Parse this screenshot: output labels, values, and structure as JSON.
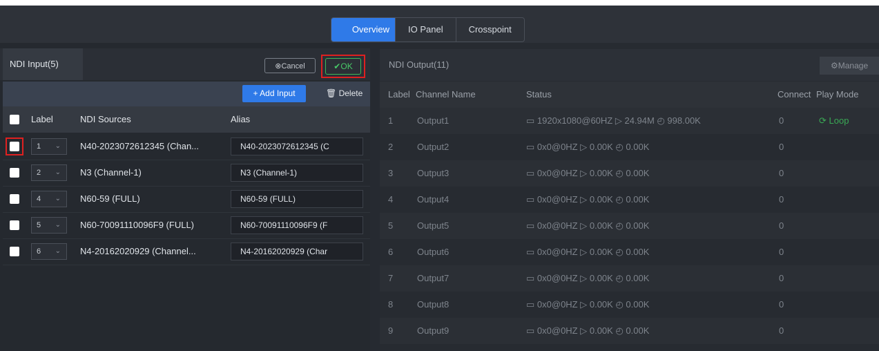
{
  "tabs": [
    "Overview",
    "IO Panel",
    "Crosspoint"
  ],
  "input_panel": {
    "title": "NDI Input(5)",
    "cancel_label": "Cancel",
    "ok_label": "OK",
    "add_label": "+ Add Input",
    "delete_label": "Delete",
    "columns": {
      "label": "Label",
      "sources": "NDI Sources",
      "alias": "Alias"
    },
    "rows": [
      {
        "label": "1",
        "source": "N40-2023072612345 (Chan...",
        "alias": "N40-2023072612345 (C"
      },
      {
        "label": "2",
        "source": "N3 (Channel-1)",
        "alias": "N3 (Channel-1)"
      },
      {
        "label": "4",
        "source": "N60-59 (FULL)",
        "alias": "N60-59 (FULL)"
      },
      {
        "label": "5",
        "source": "N60-70091110096F9 (FULL)",
        "alias": "N60-70091110096F9 (F"
      },
      {
        "label": "6",
        "source": "N4-20162020929 (Channel...",
        "alias": "N4-20162020929 (Char"
      }
    ]
  },
  "output_panel": {
    "title": "NDI Output(11)",
    "manage_label": "Manage",
    "columns": {
      "label": "Label",
      "channel": "Channel Name",
      "status": "Status",
      "connect": "Connect",
      "mode": "Play Mode"
    },
    "rows": [
      {
        "label": "1",
        "channel": "Output1",
        "status": "1920x1080@60HZ",
        "rate": "24.94M",
        "bytes": "998.00K",
        "connect": "0",
        "mode": "Loop"
      },
      {
        "label": "2",
        "channel": "Output2",
        "status": "0x0@0HZ",
        "rate": "0.00K",
        "bytes": "0.00K",
        "connect": "0",
        "mode": ""
      },
      {
        "label": "3",
        "channel": "Output3",
        "status": "0x0@0HZ",
        "rate": "0.00K",
        "bytes": "0.00K",
        "connect": "0",
        "mode": ""
      },
      {
        "label": "4",
        "channel": "Output4",
        "status": "0x0@0HZ",
        "rate": "0.00K",
        "bytes": "0.00K",
        "connect": "0",
        "mode": ""
      },
      {
        "label": "5",
        "channel": "Output5",
        "status": "0x0@0HZ",
        "rate": "0.00K",
        "bytes": "0.00K",
        "connect": "0",
        "mode": ""
      },
      {
        "label": "6",
        "channel": "Output6",
        "status": "0x0@0HZ",
        "rate": "0.00K",
        "bytes": "0.00K",
        "connect": "0",
        "mode": ""
      },
      {
        "label": "7",
        "channel": "Output7",
        "status": "0x0@0HZ",
        "rate": "0.00K",
        "bytes": "0.00K",
        "connect": "0",
        "mode": ""
      },
      {
        "label": "8",
        "channel": "Output8",
        "status": "0x0@0HZ",
        "rate": "0.00K",
        "bytes": "0.00K",
        "connect": "0",
        "mode": ""
      },
      {
        "label": "9",
        "channel": "Output9",
        "status": "0x0@0HZ",
        "rate": "0.00K",
        "bytes": "0.00K",
        "connect": "0",
        "mode": ""
      }
    ]
  }
}
